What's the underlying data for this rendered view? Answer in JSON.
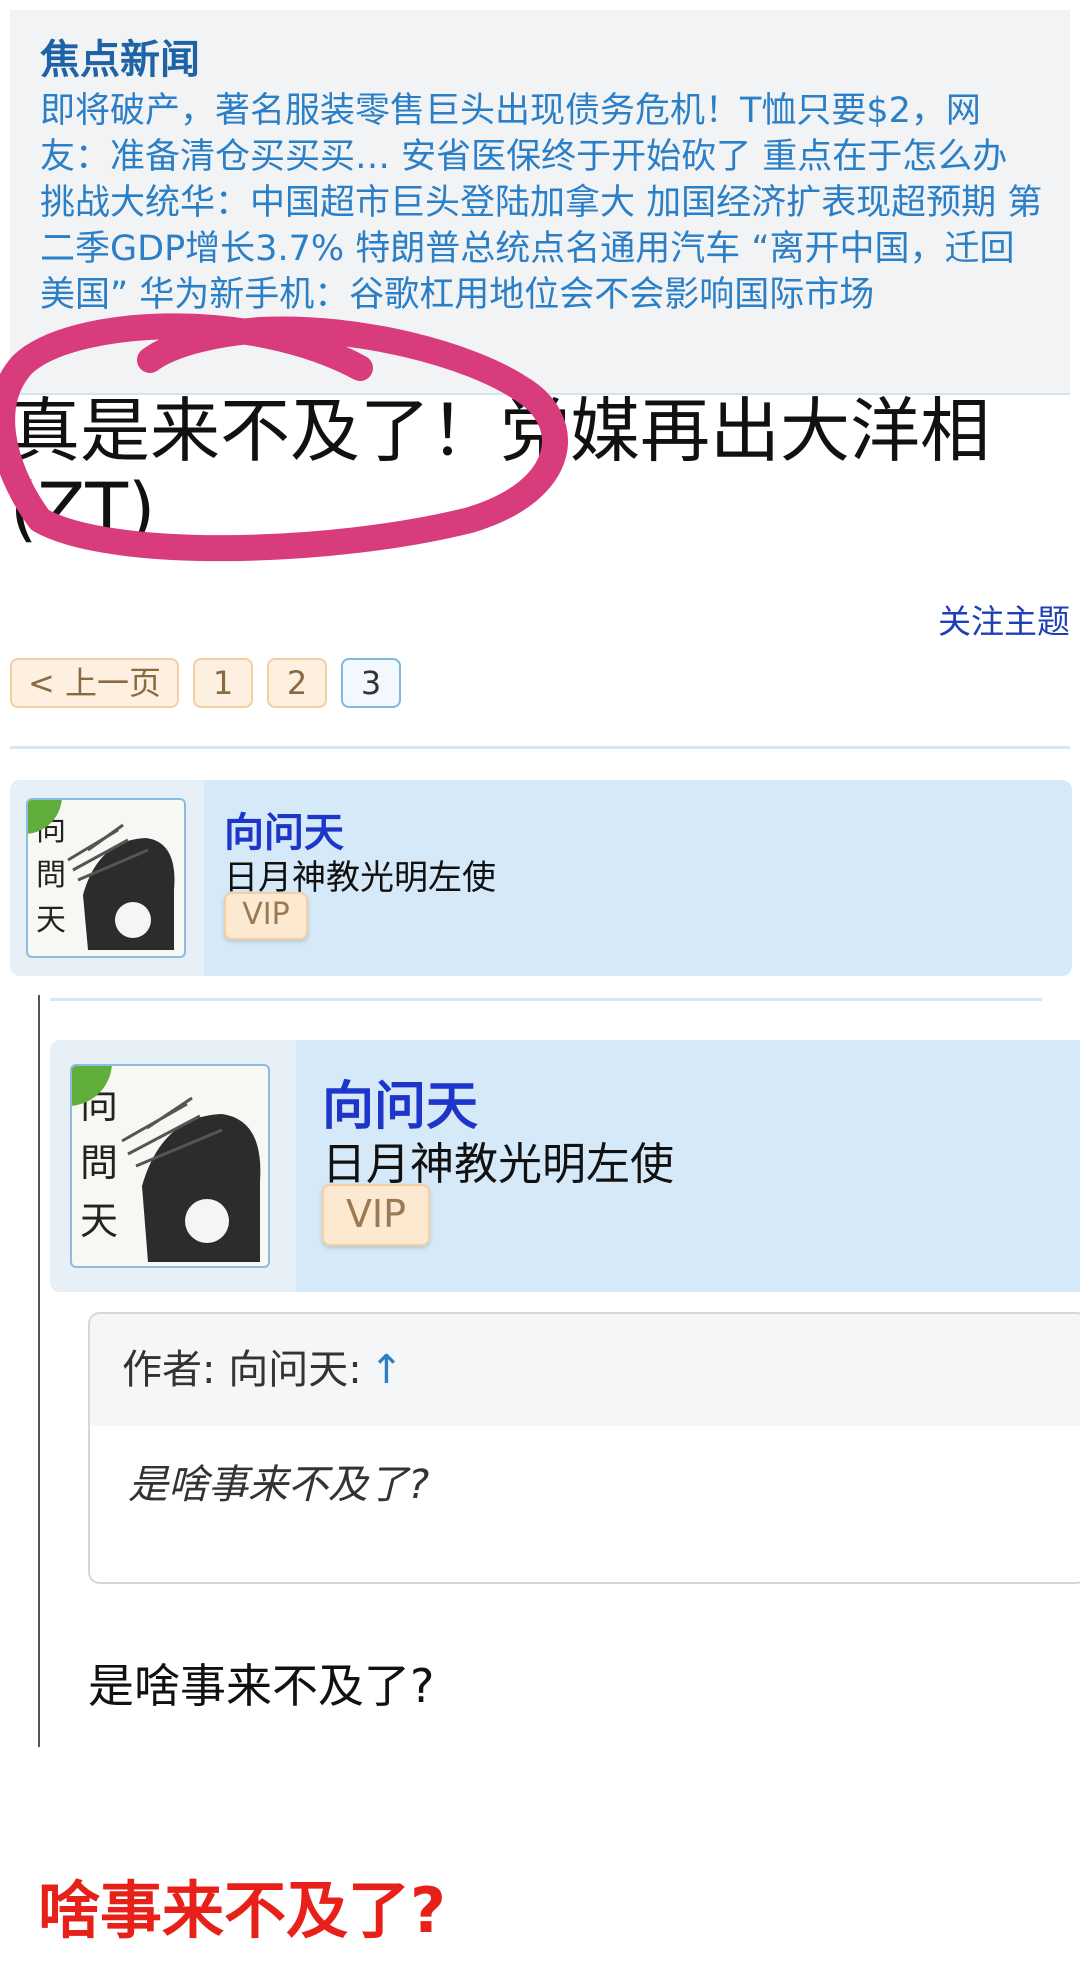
{
  "news": {
    "title": "焦点新闻",
    "items": [
      "即将破产，著名服装零售巨头出现债务危机！T恤只要$2，网友：准备清仓买买买…",
      "安省医保终于开始砍了 重点在于怎么办",
      "挑战大统华：中国超市巨头登陆加拿大",
      "加国经济扩表现超预期 第二季GDP增长3.7%",
      "特朗普总统点名通用汽车 “离开中国，迁回美国”",
      "华为新手机：谷歌杠用地位会不会影响国际市场"
    ]
  },
  "thread": {
    "title": "真是来不及了！党媒再出大洋相(ZT)",
    "follow": "关注主题"
  },
  "pager": {
    "prev": "< 上一页",
    "pages": [
      "1",
      "2",
      "3"
    ],
    "current": "3"
  },
  "users": {
    "first": {
      "name": "向问天",
      "role": "日月神教光明左使",
      "badge": "VIP",
      "avatar_text": "向\n問\n天"
    },
    "second": {
      "name": "向问天",
      "role": "日月神教光明左使",
      "badge": "VIP",
      "avatar_text": "向\n問\n天"
    }
  },
  "quote": {
    "header": "作者: 向问天:",
    "arrow": "↑",
    "text": "是啥事来不及了?"
  },
  "reply": {
    "text": "是啥事来不及了?"
  },
  "comment": {
    "text": "啥事来不及了?"
  },
  "colors": {
    "accent_blue": "#2a7fc7",
    "name_blue": "#1d35c8",
    "red": "#e8201a",
    "annotation_pink": "#d83c7c"
  }
}
